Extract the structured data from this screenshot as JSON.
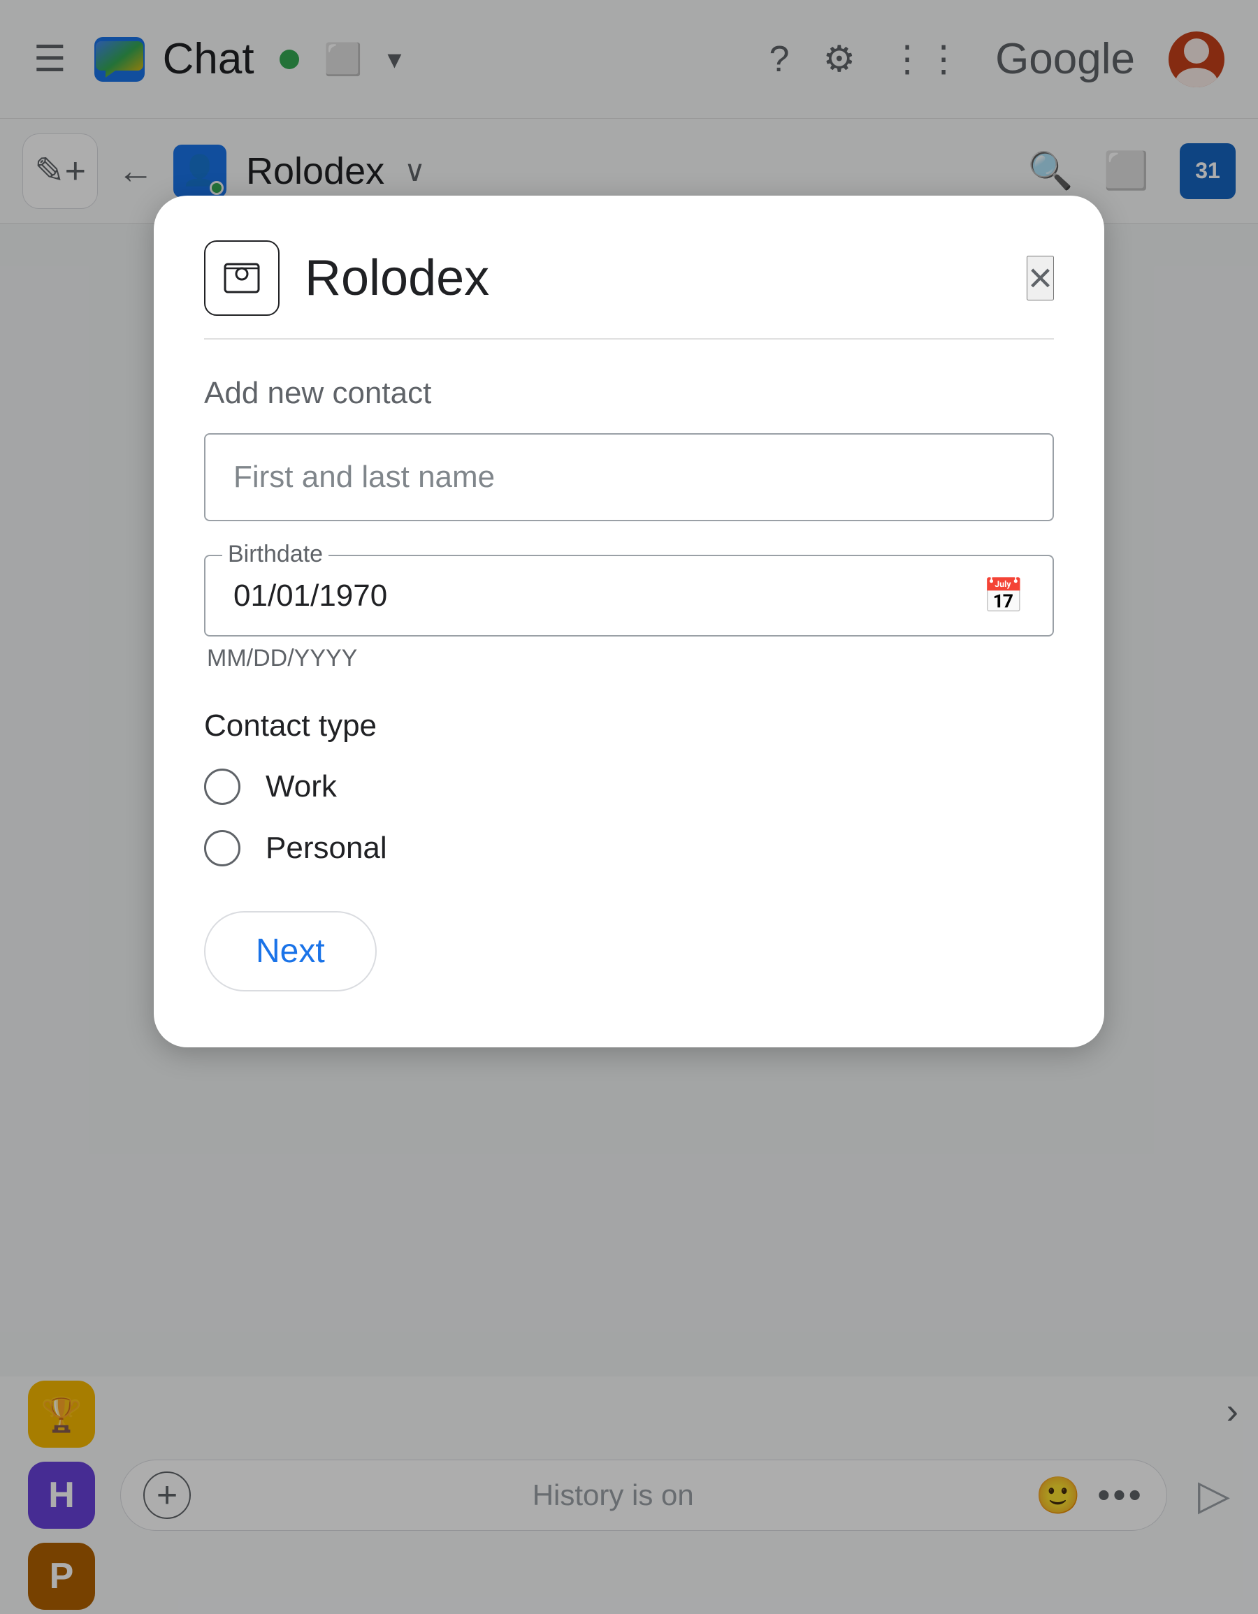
{
  "app": {
    "title": "Chat"
  },
  "header": {
    "hamburger": "☰",
    "status": "active",
    "chat_label": "Chat",
    "help_icon": "?",
    "settings_icon": "⚙",
    "grid_icon": "⋮⋮⋮",
    "google_text": "Google"
  },
  "subbar": {
    "back": "←",
    "space_name": "Rolodex",
    "dropdown": "∨"
  },
  "modal": {
    "title": "Rolodex",
    "close": "×",
    "section_label": "Add new contact",
    "name_placeholder": "First and last name",
    "birthdate": {
      "label": "Birthdate",
      "value": "01/01/1970",
      "hint": "MM/DD/YYYY"
    },
    "contact_type": {
      "label": "Contact type",
      "options": [
        "Work",
        "Personal"
      ]
    },
    "next_button": "Next"
  },
  "chat_bar": {
    "add_icon": "+",
    "history_text": "History is on",
    "emoji_icon": "🙂",
    "more_icon": "...",
    "send_icon": "▷"
  },
  "sidebar_badges": [
    "🏆",
    "H",
    "P"
  ],
  "colors": {
    "accent_blue": "#1a73e8",
    "green": "#34a853",
    "grey_text": "#5f6368"
  }
}
